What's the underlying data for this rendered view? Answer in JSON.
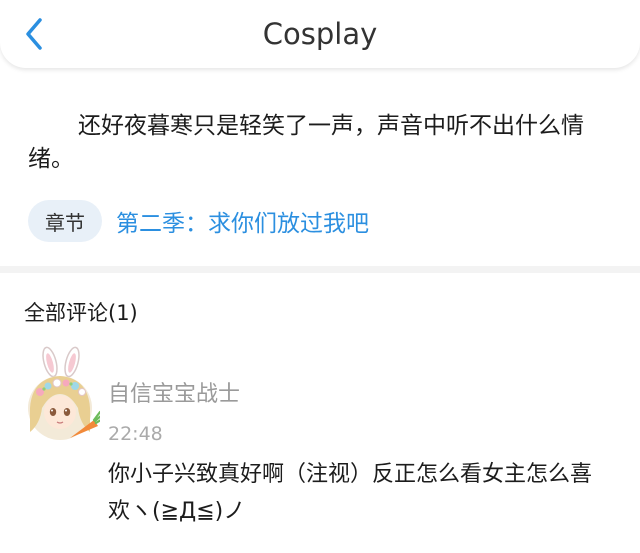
{
  "header": {
    "title": "Cosplay",
    "back_icon": "chevron-left-icon",
    "accent_color": "#2b8fe0"
  },
  "excerpt": {
    "text": "还好夜暮寒只是轻笑了一声，声音中听不出什么情绪。"
  },
  "chapter": {
    "tag_label": "章节",
    "link_text": "第二季：求你们放过我吧"
  },
  "comments": {
    "heading": "全部评论(1)",
    "items": [
      {
        "avatar_icon": "anime-girl-bunny-ears-avatar",
        "username": "自信宝宝战士",
        "time": "22:48",
        "text": "你小子兴致真好啊（注视）反正怎么看女主怎么喜欢ヽ(≧Д≦)ノ"
      }
    ]
  }
}
